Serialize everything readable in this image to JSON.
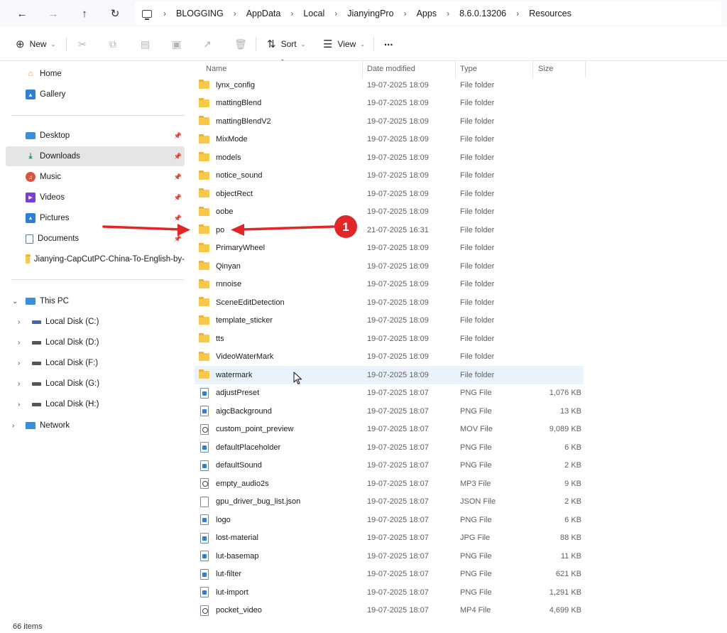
{
  "nav": {
    "back_icon": "back-arrow-icon",
    "forward_icon": "forward-arrow-icon",
    "up_icon": "up-arrow-icon",
    "refresh_icon": "refresh-icon"
  },
  "breadcrumbs": [
    "BLOGGING",
    "AppData",
    "Local",
    "JianyingPro",
    "Apps",
    "8.6.0.13206",
    "Resources"
  ],
  "toolbar": {
    "new_label": "New",
    "sort_label": "Sort",
    "view_label": "View",
    "more_label": "..."
  },
  "sidebar": {
    "quick": [
      {
        "label": "Home",
        "icon": "home-icon"
      },
      {
        "label": "Gallery",
        "icon": "gallery-icon"
      }
    ],
    "pinned": [
      {
        "label": "Desktop",
        "icon": "desktop-icon"
      },
      {
        "label": "Downloads",
        "icon": "download-icon",
        "selected": true
      },
      {
        "label": "Music",
        "icon": "music-icon"
      },
      {
        "label": "Videos",
        "icon": "videos-icon"
      },
      {
        "label": "Pictures",
        "icon": "pictures-icon"
      },
      {
        "label": "Documents",
        "icon": "documents-icon"
      },
      {
        "label": "Jianying-CapCutPC-China-To-English-by-",
        "icon": "folder-icon"
      }
    ],
    "this_pc": "This PC",
    "drives": [
      "Local Disk (C:)",
      "Local Disk (D:)",
      "Local Disk (F:)",
      "Local Disk (G:)",
      "Local Disk (H:)"
    ],
    "network": "Network"
  },
  "columns": {
    "name": "Name",
    "date": "Date modified",
    "type": "Type",
    "size": "Size"
  },
  "files": [
    {
      "name": "lynx_config",
      "date": "19-07-2025 18:09",
      "type": "File folder",
      "size": "",
      "kind": "folder"
    },
    {
      "name": "mattingBlend",
      "date": "19-07-2025 18:09",
      "type": "File folder",
      "size": "",
      "kind": "folder"
    },
    {
      "name": "mattingBlendV2",
      "date": "19-07-2025 18:09",
      "type": "File folder",
      "size": "",
      "kind": "folder"
    },
    {
      "name": "MixMode",
      "date": "19-07-2025 18:09",
      "type": "File folder",
      "size": "",
      "kind": "folder"
    },
    {
      "name": "models",
      "date": "19-07-2025 18:09",
      "type": "File folder",
      "size": "",
      "kind": "folder"
    },
    {
      "name": "notice_sound",
      "date": "19-07-2025 18:09",
      "type": "File folder",
      "size": "",
      "kind": "folder"
    },
    {
      "name": "objectRect",
      "date": "19-07-2025 18:09",
      "type": "File folder",
      "size": "",
      "kind": "folder"
    },
    {
      "name": "oobe",
      "date": "19-07-2025 18:09",
      "type": "File folder",
      "size": "",
      "kind": "folder"
    },
    {
      "name": "po",
      "date": "21-07-2025 16:31",
      "type": "File folder",
      "size": "",
      "kind": "folder"
    },
    {
      "name": "PrimaryWheel",
      "date": "19-07-2025 18:09",
      "type": "File folder",
      "size": "",
      "kind": "folder"
    },
    {
      "name": "Qinyan",
      "date": "19-07-2025 18:09",
      "type": "File folder",
      "size": "",
      "kind": "folder"
    },
    {
      "name": "rnnoise",
      "date": "19-07-2025 18:09",
      "type": "File folder",
      "size": "",
      "kind": "folder"
    },
    {
      "name": "SceneEditDetection",
      "date": "19-07-2025 18:09",
      "type": "File folder",
      "size": "",
      "kind": "folder"
    },
    {
      "name": "template_sticker",
      "date": "19-07-2025 18:09",
      "type": "File folder",
      "size": "",
      "kind": "folder"
    },
    {
      "name": "tts",
      "date": "19-07-2025 18:09",
      "type": "File folder",
      "size": "",
      "kind": "folder"
    },
    {
      "name": "VideoWaterMark",
      "date": "19-07-2025 18:09",
      "type": "File folder",
      "size": "",
      "kind": "folder"
    },
    {
      "name": "watermark",
      "date": "19-07-2025 18:09",
      "type": "File folder",
      "size": "",
      "kind": "folder",
      "hover": true
    },
    {
      "name": "adjustPreset",
      "date": "19-07-2025 18:07",
      "type": "PNG File",
      "size": "1,076 KB",
      "kind": "png"
    },
    {
      "name": "aigcBackground",
      "date": "19-07-2025 18:07",
      "type": "PNG File",
      "size": "13 KB",
      "kind": "png"
    },
    {
      "name": "custom_point_preview",
      "date": "19-07-2025 18:07",
      "type": "MOV File",
      "size": "9,089 KB",
      "kind": "mov"
    },
    {
      "name": "defaultPlaceholder",
      "date": "19-07-2025 18:07",
      "type": "PNG File",
      "size": "6 KB",
      "kind": "png"
    },
    {
      "name": "defaultSound",
      "date": "19-07-2025 18:07",
      "type": "PNG File",
      "size": "2 KB",
      "kind": "png"
    },
    {
      "name": "empty_audio2s",
      "date": "19-07-2025 18:07",
      "type": "MP3 File",
      "size": "9 KB",
      "kind": "mp3"
    },
    {
      "name": "gpu_driver_bug_list.json",
      "date": "19-07-2025 18:07",
      "type": "JSON File",
      "size": "2 KB",
      "kind": "json"
    },
    {
      "name": "logo",
      "date": "19-07-2025 18:07",
      "type": "PNG File",
      "size": "6 KB",
      "kind": "png"
    },
    {
      "name": "lost-material",
      "date": "19-07-2025 18:07",
      "type": "JPG File",
      "size": "88 KB",
      "kind": "jpg"
    },
    {
      "name": "lut-basemap",
      "date": "19-07-2025 18:07",
      "type": "PNG File",
      "size": "11 KB",
      "kind": "png"
    },
    {
      "name": "lut-filter",
      "date": "19-07-2025 18:07",
      "type": "PNG File",
      "size": "621 KB",
      "kind": "png"
    },
    {
      "name": "lut-import",
      "date": "19-07-2025 18:07",
      "type": "PNG File",
      "size": "1,291 KB",
      "kind": "png"
    },
    {
      "name": "pocket_video",
      "date": "19-07-2025 18:07",
      "type": "MP4 File",
      "size": "4,699 KB",
      "kind": "mp4"
    }
  ],
  "status": {
    "count": "66 items"
  },
  "annotation": {
    "badge": "1",
    "color": "#e02626"
  }
}
